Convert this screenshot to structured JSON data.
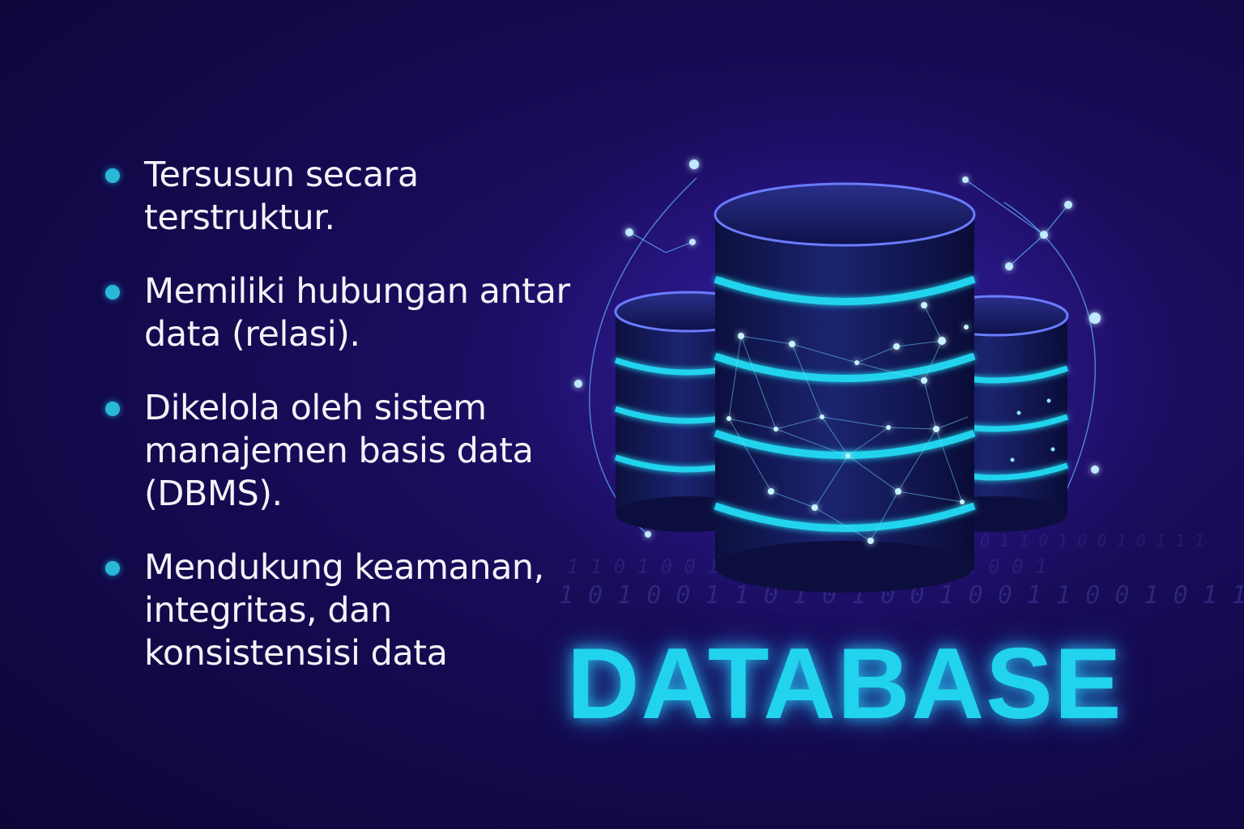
{
  "bullets": [
    {
      "text": "Tersusun secara terstruktur."
    },
    {
      "text": "Memiliki hubungan antar data (relasi)."
    },
    {
      "text": "Dikelola oleh sistem manajemen basis data (DBMS)."
    },
    {
      "text": "Mendukung keamanan, integritas, dan konsistensisi data"
    }
  ],
  "title": "DATABASE",
  "binary_rows": [
    "1 0 1 0 0 1 1 0 1 0 1 0 0 1 0 0 1 1 0 0 1 0 1 1 0 1 1 1",
    "1 1 0 1 0 0 1 0 1 1 0 1 0 0 1 0 1 1 0 0 1",
    "0 1 1 0 1 0 0 1 0 1 1 1"
  ],
  "colors": {
    "accent": "#22d3ee",
    "bullet": "#29b8d8",
    "text": "#f2f2f8",
    "background": "#150a52"
  },
  "icons": [
    "bullet-dot-icon",
    "database-cylinder-icon",
    "network-node-icon"
  ]
}
